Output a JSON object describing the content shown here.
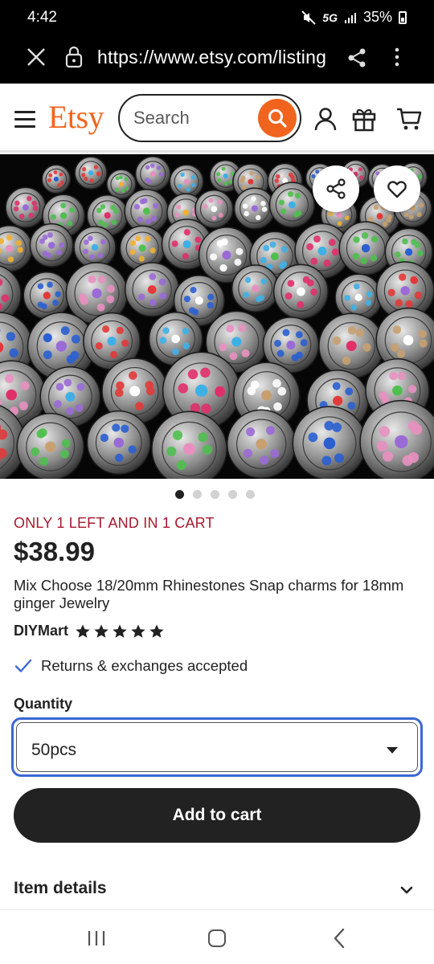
{
  "status_bar": {
    "time": "4:42",
    "network": "5G",
    "battery": "35%"
  },
  "browser": {
    "url": "https://www.etsy.com/listing"
  },
  "header": {
    "logo": "Etsy",
    "search_placeholder": "Search",
    "accent_color": "#f1641e"
  },
  "gallery": {
    "image_count": 5,
    "active_index": 0
  },
  "product": {
    "stock_notice": "ONLY 1 LEFT AND IN 1 CART",
    "price": "$38.99",
    "title": "Mix Choose 18/20mm Rhinestones Snap charms for 18mm ginger Jewelry",
    "shop_name": "DIYMart",
    "rating": 5,
    "returns": "Returns & exchanges accepted"
  },
  "quantity": {
    "label": "Quantity",
    "selected": "50pcs"
  },
  "actions": {
    "add_to_cart": "Add to cart"
  },
  "sections": {
    "item_details": "Item details"
  }
}
